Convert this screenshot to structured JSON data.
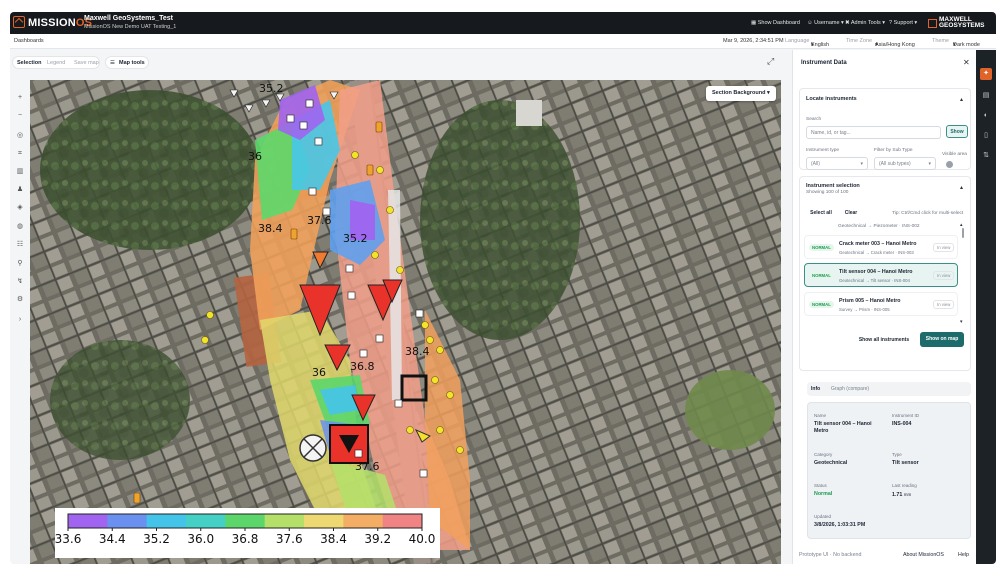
{
  "header": {
    "brand_a": "MISSION",
    "brand_b": "OS",
    "org_name": "Maxwell GeoSystems_Test",
    "project_name": "MissionOS New Demo UAT Testing_1",
    "nav": [
      "Show Dashboard",
      "Username",
      "Admin Tools",
      "Support"
    ],
    "company_line1": "MAXWELL",
    "company_line2": "GEOSYSTEMS"
  },
  "subbar": {
    "breadcrumb": "Dashboards",
    "datetime": "Mar 9, 2026, 2:34:51 PM",
    "language_label": "Language",
    "language_value": "English",
    "timezone_label": "Time Zone",
    "timezone_value": "Asia/Hong Kong",
    "theme_label": "Theme",
    "theme_value": "Dark mode"
  },
  "toolbar": {
    "selection": "Selection",
    "legend": "Legend",
    "save_map": "Save map",
    "map_tools": "Map tools"
  },
  "map": {
    "section_background": "Section Background",
    "contour_labels": [
      "35.2",
      "36",
      "37.6",
      "38.4",
      "35.2",
      "36",
      "36.8",
      "37.6",
      "38.4"
    ],
    "colorbar_ticks": [
      "33.6",
      "34.4",
      "35.2",
      "36.0",
      "36.8",
      "37.6",
      "38.4",
      "39.2",
      "40.0"
    ],
    "colorbar_colors": [
      "#a064f0",
      "#6a90f0",
      "#45c4ea",
      "#44d0c4",
      "#5cd66a",
      "#b4e06a",
      "#eed872",
      "#f4ad64",
      "#f08484"
    ]
  },
  "panel": {
    "title": "Instrument Data",
    "locate_title": "Locate instruments",
    "search_label": "Search",
    "search_placeholder": "Name, id, or tag...",
    "show_button": "Show",
    "instrument_type_label": "Instrument type",
    "instrument_type_value": "(All)",
    "subtype_label": "Filter by Sub Type",
    "subtype_value": "(All sub types)",
    "visible_area_label": "Visible area",
    "selection_title": "Instrument selection",
    "selection_count": "Showing 100 of 100",
    "select_all": "Select all",
    "clear": "Clear",
    "tip": "Tip: Ctrl/Cmd click for multi-select",
    "partial_top_sub": "Geotechnical → Piezometer · INS-002",
    "instruments": [
      {
        "status": "NORMAL",
        "name": "Crack meter 003 – Hanoi Metro",
        "sub": "Geotechnical → Crack meter · INS-003",
        "view": "In view"
      },
      {
        "status": "NORMAL",
        "name": "Tilt sensor 004 – Hanoi Metro",
        "sub": "Geotechnical → Tilt sensor · INS-004",
        "view": "In view"
      },
      {
        "status": "NORMAL",
        "name": "Prism 005 – Hanoi Metro",
        "sub": "Survey → Prism · INS-005",
        "view": "In view"
      }
    ],
    "show_all": "Show all instruments",
    "show_on_map": "Show on map",
    "tab_info": "Info",
    "tab_graph": "Graph (compare)",
    "info": {
      "name_label": "Name",
      "name_value": "Tilt sensor 004 – Hanoi Metro",
      "id_label": "Instrument ID",
      "id_value": "INS-004",
      "category_label": "Category",
      "category_value": "Geotechnical",
      "type_label": "Type",
      "type_value": "Tilt sensor",
      "status_label": "Status",
      "status_value": "Normal",
      "reading_label": "Last reading",
      "reading_value": "1.71",
      "reading_unit": "mm",
      "updated_label": "Updated",
      "updated_value": "3/8/2026, 1:03:31 PM"
    },
    "footer_left": "Prototype UI · No backend",
    "footer_about": "About MissionOS",
    "footer_help": "Help"
  },
  "colors": {
    "accent": "#e0632a",
    "teal": "#1e6b6b",
    "normal": "#1d9b52"
  }
}
